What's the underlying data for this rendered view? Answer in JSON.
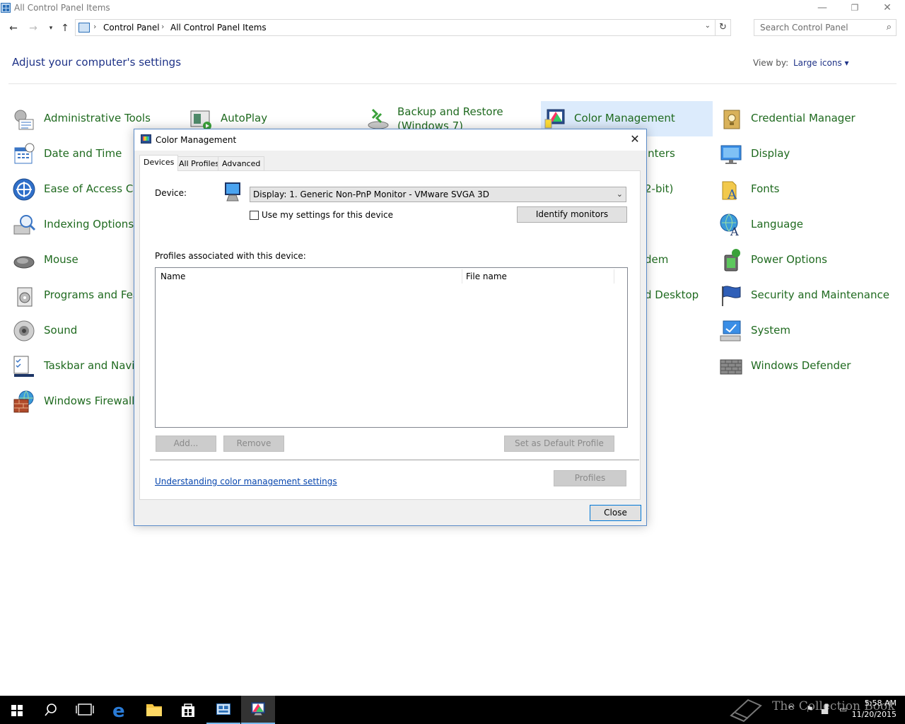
{
  "window": {
    "title": "All Control Panel Items",
    "minimize": "—",
    "restore": "❐",
    "close": "✕"
  },
  "address": {
    "crumbs": [
      "Control Panel",
      "All Control Panel Items"
    ],
    "search_placeholder": "Search Control Panel"
  },
  "header": {
    "title": "Adjust your computer's settings",
    "view_by_label": "View by:",
    "view_by_value": "Large icons ▾"
  },
  "items": {
    "admin_tools": "Administrative Tools",
    "autoplay": "AutoPlay",
    "backup": "Backup and Restore (Windows 7)",
    "color_mgmt": "Color Management",
    "credential": "Credential Manager",
    "date_time": "Date and Time",
    "printers_part": "inters",
    "display": "Display",
    "ease": "Ease of Access Cen",
    "bit_part": "2-bit)",
    "fonts": "Fonts",
    "indexing": "Indexing Options",
    "language": "Language",
    "mouse": "Mouse",
    "modem_part": "dem",
    "power": "Power Options",
    "programs": "Programs and Feat",
    "desktop_part": "d Desktop",
    "security": "Security and Maintenance",
    "sound": "Sound",
    "system": "System",
    "taskbar": "Taskbar and Navig",
    "defender": "Windows Defender",
    "firewall": "Windows Firewall"
  },
  "dialog": {
    "title": "Color Management",
    "close_x": "✕",
    "tabs": [
      "Devices",
      "All Profiles",
      "Advanced"
    ],
    "device_label": "Device:",
    "device_value": "Display: 1. Generic Non-PnP Monitor - VMware SVGA 3D",
    "use_settings": "Use my settings for this device",
    "identify": "Identify monitors",
    "profiles_label": "Profiles associated with this device:",
    "columns": [
      "Name",
      "File name"
    ],
    "add": "Add...",
    "remove": "Remove",
    "set_default": "Set as Default Profile",
    "link": "Understanding color management settings",
    "profiles": "Profiles",
    "close": "Close"
  },
  "taskbar": {
    "time": "5:58 AM",
    "date": "11/20/2015",
    "watermark": "The Collection Book"
  }
}
